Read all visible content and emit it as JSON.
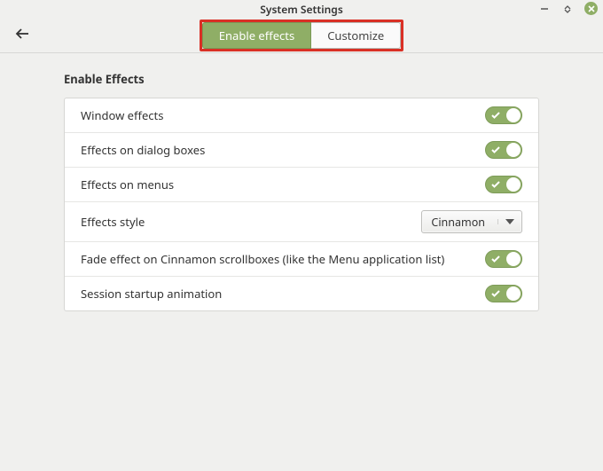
{
  "window": {
    "title": "System Settings"
  },
  "tabs": {
    "enable_effects": "Enable effects",
    "customize": "Customize"
  },
  "section": {
    "title": "Enable Effects"
  },
  "rows": {
    "window_effects": "Window effects",
    "dialog_boxes": "Effects on dialog boxes",
    "menus": "Effects on menus",
    "style_label": "Effects style",
    "style_value": "Cinnamon",
    "fade": "Fade effect on Cinnamon scrollboxes (like the Menu application list)",
    "startup": "Session startup animation"
  }
}
